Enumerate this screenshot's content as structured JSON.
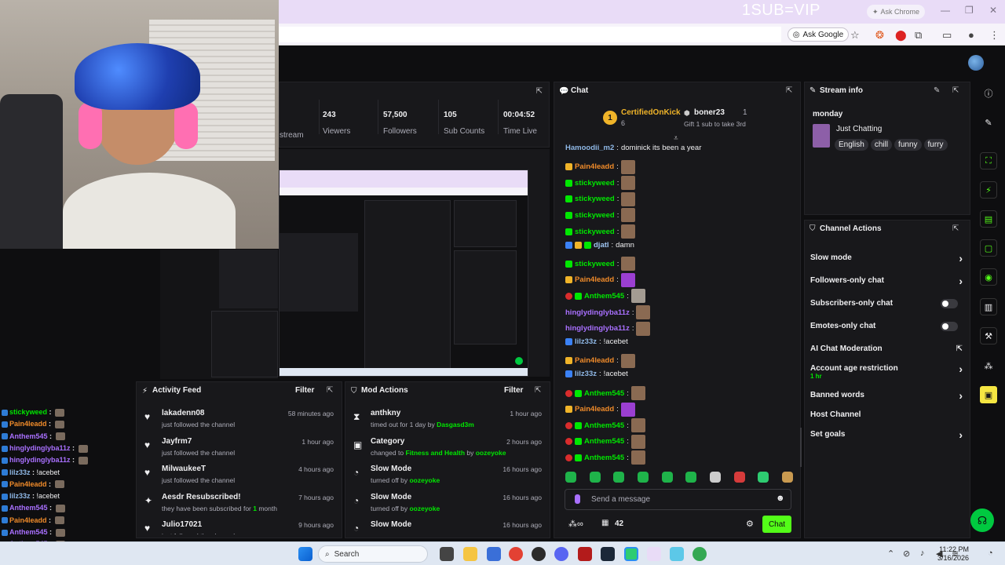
{
  "browser": {
    "overlay_title": "1SUB=VIP",
    "ask_chrome": "Ask Chrome",
    "ask_google": "Ask Google"
  },
  "stats": {
    "partial_label": "stream",
    "items": [
      {
        "value": "243",
        "label": "Viewers"
      },
      {
        "value": "57,500",
        "label": "Followers"
      },
      {
        "value": "105",
        "label": "Sub Counts"
      },
      {
        "value": "00:04:52",
        "label": "Time Live"
      }
    ]
  },
  "obs_chat": [
    {
      "user": "stickyweed",
      "color": "#00e701"
    },
    {
      "user": "Pain4leadd",
      "color": "#f08b2a"
    },
    {
      "user": "Anthem545",
      "color": "#a970ff"
    },
    {
      "user": "hinglydinglyba11z",
      "color": "#a970ff"
    },
    {
      "user": "hinglydinglyba11z",
      "color": "#a970ff"
    },
    {
      "user": "lilz33z",
      "color": "#8fb8e6",
      "msg": "!acebet"
    },
    {
      "user": "Pain4leadd",
      "color": "#f08b2a"
    },
    {
      "user": "lilz33z",
      "color": "#8fb8e6",
      "msg": "!acebet"
    },
    {
      "user": "Anthem545",
      "color": "#a970ff"
    },
    {
      "user": "Pain4leadd",
      "color": "#f08b2a"
    },
    {
      "user": "Anthem545",
      "color": "#a970ff"
    },
    {
      "user": "Anthem545",
      "color": "#a970ff"
    },
    {
      "user": "Anthem545",
      "color": "#a970ff"
    }
  ],
  "activity": {
    "title": "Activity Feed",
    "filter": "Filter",
    "items": [
      {
        "icon": "♥",
        "name": "lakadenn08",
        "sub": "just followed the channel",
        "time": "58 minutes ago"
      },
      {
        "icon": "♥",
        "name": "Jayfrm7",
        "sub": "just followed the channel",
        "time": "1 hour ago"
      },
      {
        "icon": "♥",
        "name": "MilwaukeeT",
        "sub": "just followed the channel",
        "time": "4 hours ago"
      },
      {
        "icon": "✦",
        "name": "Aesdr Resubscribed!",
        "sub_pre": "they have been subscribed for ",
        "sub_hl": "1",
        "sub_post": " month",
        "time": "7 hours ago"
      },
      {
        "icon": "♥",
        "name": "Julio17021",
        "sub": "just followed the channel",
        "time": "9 hours ago"
      }
    ]
  },
  "mod_actions": {
    "title": "Mod Actions",
    "filter": "Filter",
    "items": [
      {
        "icon": "⧗",
        "name": "anthkny",
        "sub_pre": "timed out for 1 day by ",
        "sub_hl": "Dasgasd3m",
        "time": "1 hour ago"
      },
      {
        "icon": "▣",
        "name": "Category",
        "sub_pre": "changed to ",
        "sub_hl": "Fitness and Health",
        "sub_mid": " by ",
        "sub_hl2": "oozeyoke",
        "time": "2 hours ago"
      },
      {
        "icon": "◔",
        "name": "Slow Mode",
        "sub_pre": "turned off by ",
        "sub_hl": "oozeyoke",
        "time": "16 hours ago"
      },
      {
        "icon": "◔",
        "name": "Slow Mode",
        "sub_pre": "turned off by ",
        "sub_hl": "oozeyoke",
        "time": "16 hours ago"
      },
      {
        "icon": "◔",
        "name": "Slow Mode",
        "sub_pre": "",
        "sub_hl": "",
        "time": "16 hours ago"
      }
    ]
  },
  "chat": {
    "title": "Chat",
    "pinned": {
      "rank": "1",
      "user1": "CertifiedOnKick",
      "user1_count": "6",
      "user2": "boner23",
      "user2_count": "1",
      "gift": "Gift 1 sub to take 3rd"
    },
    "messages": [
      {
        "user": "Hamoodii_m2",
        "cls": "u-lblue",
        "badges": [],
        "msg": "dominick its been a year"
      },
      {
        "user": "Pain4leadd",
        "cls": "u-orange",
        "badges": [
          "gold"
        ],
        "emote": "brown"
      },
      {
        "user": "stickyweed",
        "cls": "u-green",
        "badges": [
          "green"
        ],
        "emote": "brown"
      },
      {
        "user": "stickyweed",
        "cls": "u-green",
        "badges": [
          "green"
        ],
        "emote": "brown"
      },
      {
        "user": "stickyweed",
        "cls": "u-green",
        "badges": [
          "green"
        ],
        "emote": "brown"
      },
      {
        "user": "stickyweed",
        "cls": "u-green",
        "badges": [
          "green"
        ],
        "emote": "brown"
      },
      {
        "user": "djatl",
        "cls": "u-blue",
        "badges": [
          "blue",
          "gold",
          "green"
        ],
        "msg": "damn"
      },
      {
        "user": "stickyweed",
        "cls": "u-green",
        "badges": [
          "green"
        ],
        "emote": "brown"
      },
      {
        "user": "Pain4leadd",
        "cls": "u-orange",
        "badges": [
          "gold"
        ],
        "emote": "purple"
      },
      {
        "user": "Anthem545",
        "cls": "u-green",
        "badges": [
          "red",
          "green"
        ],
        "emote": "gray"
      },
      {
        "user": "hinglydinglyba11z",
        "cls": "u-purple",
        "badges": [],
        "emote": "brown"
      },
      {
        "user": "hinglydinglyba11z",
        "cls": "u-purple",
        "badges": [],
        "emote": "brown"
      },
      {
        "user": "lilz33z",
        "cls": "u-lblue",
        "badges": [
          "blue"
        ],
        "msg": "!acebet"
      },
      {
        "user": "Pain4leadd",
        "cls": "u-orange",
        "badges": [
          "gold"
        ],
        "emote": "brown"
      },
      {
        "user": "lilz33z",
        "cls": "u-lblue",
        "badges": [
          "blue"
        ],
        "msg": "!acebet"
      },
      {
        "user": "Anthem545",
        "cls": "u-green",
        "badges": [
          "red",
          "green"
        ],
        "emote": "brown"
      },
      {
        "user": "Pain4leadd",
        "cls": "u-orange",
        "badges": [
          "gold"
        ],
        "emote": "purple"
      },
      {
        "user": "Anthem545",
        "cls": "u-green",
        "badges": [
          "red",
          "green"
        ],
        "emote": "brown"
      },
      {
        "user": "Anthem545",
        "cls": "u-green",
        "badges": [
          "red",
          "green"
        ],
        "emote": "brown"
      },
      {
        "user": "Anthem545",
        "cls": "u-green",
        "badges": [
          "red",
          "green"
        ],
        "emote": "brown"
      }
    ],
    "input_placeholder": "Send a message",
    "viewer_count": "42",
    "send_label": "Chat"
  },
  "stream_info": {
    "title": "Stream info",
    "stream_title": "monday",
    "category": "Just Chatting",
    "tags": [
      "English",
      "chill",
      "funny",
      "furry"
    ]
  },
  "channel_actions": {
    "title": "Channel Actions",
    "items": [
      {
        "label": "Slow mode",
        "kind": "chevron"
      },
      {
        "label": "Followers-only chat",
        "kind": "chevron"
      },
      {
        "label": "Subscribers-only chat",
        "kind": "toggle"
      },
      {
        "label": "Emotes-only chat",
        "kind": "toggle"
      },
      {
        "label": "AI Chat Moderation",
        "kind": "external"
      },
      {
        "label": "Account age restriction",
        "kind": "chevron",
        "sub": "1 hr"
      },
      {
        "label": "Banned words",
        "kind": "chevron"
      },
      {
        "label": "Host Channel",
        "kind": "none"
      },
      {
        "label": "Set goals",
        "kind": "chevron"
      }
    ]
  },
  "taskbar": {
    "search": "Search",
    "time": "11:22 PM",
    "date": "3/16/2026"
  },
  "colors": {
    "accent": "#53fc18",
    "background": "#0e0e10",
    "panel": "#18181b"
  }
}
